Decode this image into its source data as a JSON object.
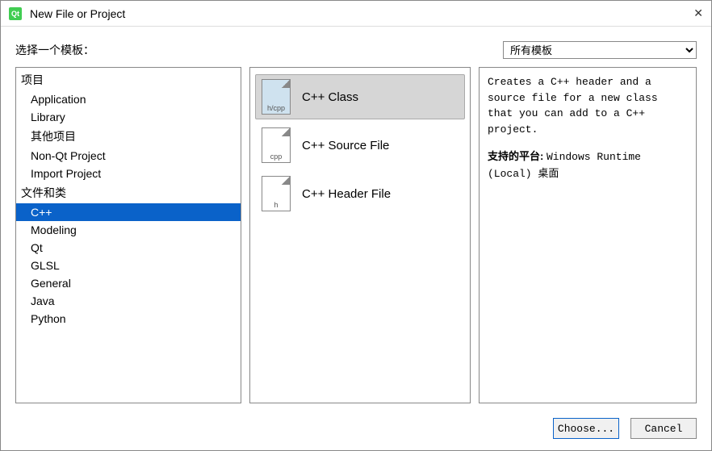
{
  "window": {
    "title": "New File or Project"
  },
  "header": {
    "label": "选择一个模板：",
    "filter_selected": "所有模板"
  },
  "categories": {
    "group1_header": "项目",
    "group1": [
      "Application",
      "Library",
      "其他项目",
      "Non-Qt Project",
      "Import Project"
    ],
    "group2_header": "文件和类",
    "group2": [
      "C++",
      "Modeling",
      "Qt",
      "GLSL",
      "General",
      "Java",
      "Python"
    ],
    "selected": "C++"
  },
  "templates": [
    {
      "label": "C++ Class",
      "icon_text": "h/cpp",
      "icon_blue": true,
      "selected": true
    },
    {
      "label": "C++ Source File",
      "icon_text": "cpp",
      "icon_blue": false,
      "selected": false
    },
    {
      "label": "C++ Header File",
      "icon_text": "h",
      "icon_blue": false,
      "selected": false
    }
  ],
  "description": {
    "text": "Creates a C++ header and a source file for a new class that you can add to a C++ project.",
    "platform_label": "支持的平台:",
    "platform_value": "Windows Runtime (Local) 桌面"
  },
  "buttons": {
    "choose": "Choose...",
    "cancel": "Cancel"
  }
}
